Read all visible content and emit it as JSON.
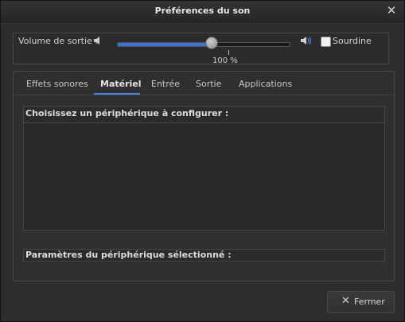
{
  "window": {
    "title": "Préférences du son"
  },
  "volume": {
    "label": "Volume de sortie :",
    "level_percent": 55,
    "marker_text": "100 %",
    "marker_value_percent": 65,
    "mute_label": "Sourdine",
    "mute_checked": false
  },
  "tabs": [
    {
      "label": "Effets sonores",
      "active": false
    },
    {
      "label": "Matériel",
      "active": true
    },
    {
      "label": "Entrée",
      "active": false
    },
    {
      "label": "Sortie",
      "active": false
    },
    {
      "label": "Applications",
      "active": false
    }
  ],
  "hardware": {
    "devices_title": "Choisissez un périphérique à configurer :",
    "devices": [],
    "settings_title": "Paramètres du périphérique sélectionné :"
  },
  "buttons": {
    "close_label": "Fermer",
    "close_icon": "close-icon"
  },
  "colors": {
    "accent": "#3b76d6",
    "background": "#2d2d2d"
  }
}
